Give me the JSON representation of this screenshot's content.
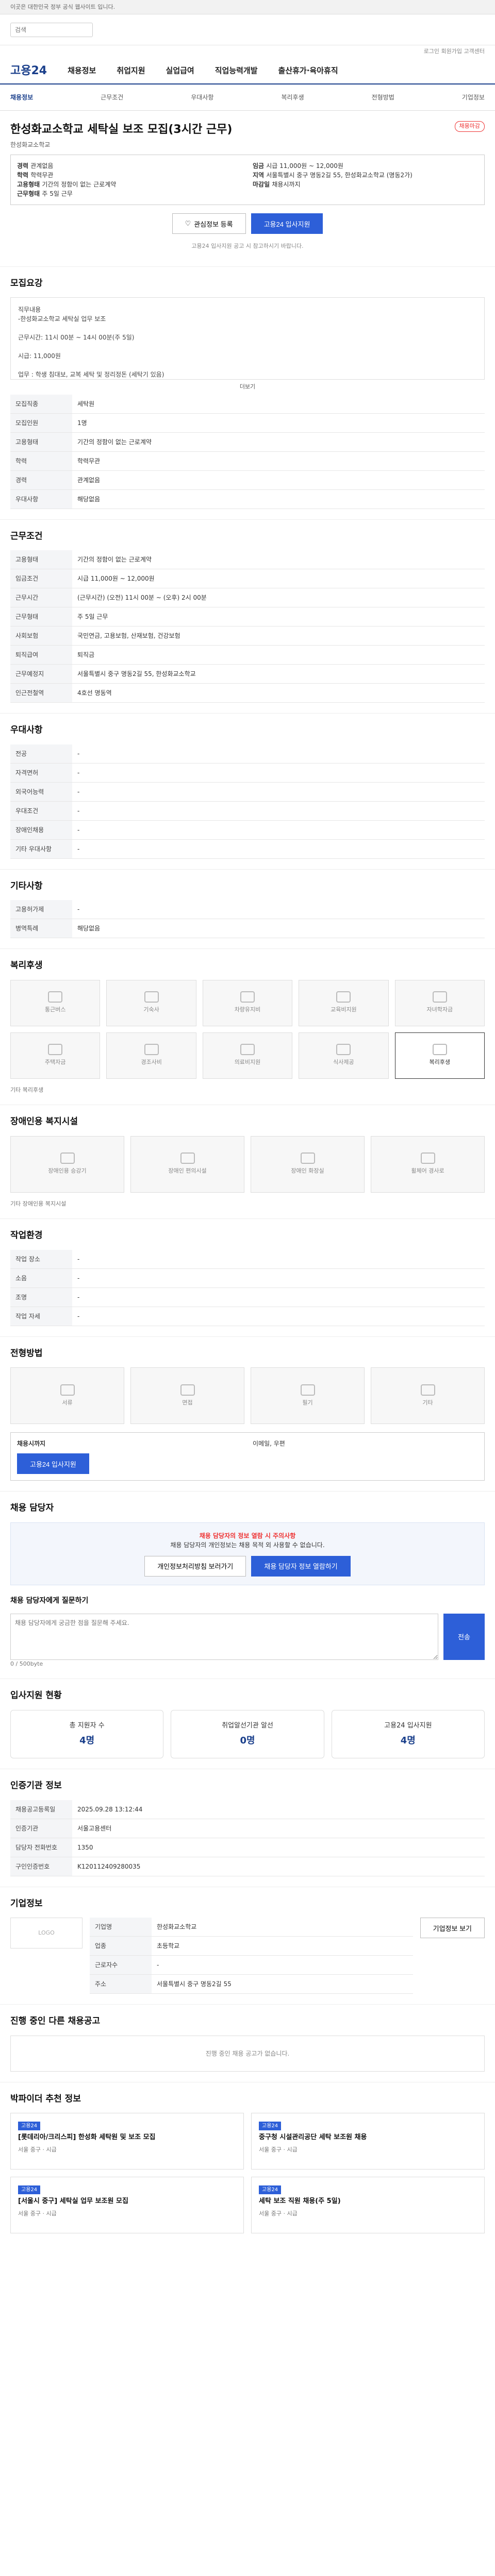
{
  "topbar": "이곳은 대한민국 정부 공식 웹사이트 입니다.",
  "header": {
    "search_placeholder": "검색",
    "util": "로그인  회원가입  고객센터"
  },
  "gnb": {
    "logo": "고용24",
    "menu": [
      "채용정보",
      "취업지원",
      "실업급여",
      "직업능력개발",
      "출산휴가·육아휴직"
    ]
  },
  "tabs": [
    "채용정보",
    "근무조건",
    "우대사항",
    "복리후생",
    "전형방법",
    "기업정보"
  ],
  "job": {
    "badge": "채용마감",
    "title": "한성화교소학교 세탁실 보조 모집(3시간 근무)",
    "company": "한성화교소학교"
  },
  "summary": {
    "left": [
      [
        "경력",
        "관계없음"
      ],
      [
        "학력",
        "학력무관"
      ],
      [
        "고용형태",
        "기간의 정함이 없는 근로계약"
      ],
      [
        "근무형태",
        "주 5일 근무"
      ]
    ],
    "right": [
      [
        "임금",
        "시급 11,000원 ~ 12,000원"
      ],
      [
        "지역",
        "서울특별시 중구 명동2길 55, 한성화교소학교 (명동2가)"
      ],
      [
        "마감일",
        "채용시까지"
      ]
    ]
  },
  "actions": {
    "scrap": "관심정보 등록",
    "apply": "고용24 입사지원"
  },
  "note": "고용24 입사지원 공고 시 참고하시기 바랍니다.",
  "detail": {
    "heading": "모집요강",
    "body": "직무내용\n-한성화교소학교 세탁실 업무 보조\n\n근무시간: 11시 00분 ~ 14시 00분(주 5일)\n\n시급: 11,000원\n\n업무 : 학생 침대보, 교복 세탁 및 정리정돈 (세탁기 있음)",
    "more": "더보기"
  },
  "recruit": [
    [
      "모집직종",
      "세탁원"
    ],
    [
      "모집인원",
      "1명"
    ],
    [
      "고용형태",
      "기간의 정함이 없는 근로계약"
    ],
    [
      "학력",
      "학력무관"
    ],
    [
      "경력",
      "관계없음"
    ],
    [
      "우대사항",
      "해당없음"
    ]
  ],
  "condition_heading": "근무조건",
  "condition": [
    [
      "고용형태",
      "기간의 정함이 없는 근로계약"
    ],
    [
      "임금조건",
      "시급 11,000원 ~ 12,000원"
    ],
    [
      "근무시간",
      "(근무시간) (오전) 11시 00분 ~ (오후) 2시 00분"
    ],
    [
      "근무형태",
      "주 5일 근무"
    ],
    [
      "사회보험",
      "국민연금, 고용보험, 산재보험, 건강보험"
    ],
    [
      "퇴직급여",
      "퇴직금"
    ],
    [
      "근무예정지",
      "서울특별시 중구 명동2길 55, 한성화교소학교"
    ],
    [
      "인근전철역",
      "4호선 명동역"
    ]
  ],
  "pref_heading": "우대사항",
  "pref": [
    [
      "전공",
      "-"
    ],
    [
      "자격면허",
      "-"
    ],
    [
      "외국어능력",
      "-"
    ],
    [
      "우대조건",
      "-"
    ],
    [
      "장애인채용",
      "-"
    ],
    [
      "기타 우대사항",
      "-"
    ]
  ],
  "etc_heading": "기타사항",
  "etc": [
    [
      "고용허가제",
      "-"
    ],
    [
      "병역특례",
      "해당없음"
    ]
  ],
  "welfare_heading": "복리후생",
  "welfare": [
    "통근버스",
    "기숙사",
    "차량유지비",
    "교육비지원",
    "자녀학자금",
    "주택자금",
    "경조사비",
    "의료비지원",
    "식사제공",
    "복리후생"
  ],
  "welfare_etc": "기타 복리후생",
  "facility_heading": "장애인용 복지시설",
  "facility": [
    "장애인용 승강기",
    "장애인 편의시설",
    "장애인 화장실",
    "휠체어 경사로"
  ],
  "facility_etc": "기타 장애인용 복지시설",
  "env_heading": "작업환경",
  "env": [
    [
      "작업 장소",
      "-"
    ],
    [
      "소음",
      "-"
    ],
    [
      "조명",
      "-"
    ],
    [
      "작업 자세",
      "-"
    ]
  ],
  "method_heading": "전형방법",
  "method": [
    "서류",
    "면접",
    "필기",
    "기타"
  ],
  "apply": {
    "deadline": "채용시까지",
    "method": "이메일, 우편",
    "button": "고용24 입사지원"
  },
  "contact_heading": "채용 담당자",
  "contact": {
    "msg": "채용 담당자의 정보 열람 시 주의사항",
    "sub": "채용 담당자의 개인정보는 채용 목적 외 사용할 수 없습니다.",
    "btn1": "개인정보처리방침 보러가기",
    "btn2": "채용 담당자 정보 열람하기"
  },
  "ask": {
    "heading": "채용 담당자에게 질문하기",
    "placeholder": "채용 담당자에게 궁금한 점을 질문해 주세요.",
    "count": "0 / 500byte",
    "button": "전송"
  },
  "stats_heading": "입사지원 현황",
  "stats": [
    [
      "총 지원자 수",
      "4명"
    ],
    [
      "취업알선기관 알선",
      "0명"
    ],
    [
      "고용24 입사지원",
      "4명"
    ]
  ],
  "agency_heading": "인증기관 정보",
  "agency": [
    [
      "채용공고등록일",
      "2025.09.28 13:12:44"
    ],
    [
      "인증기관",
      "서울고용센터"
    ],
    [
      "담당자 전화번호",
      "1350"
    ],
    [
      "구인인증번호",
      "K120112409280035"
    ]
  ],
  "company_heading": "기업정보",
  "company": {
    "logo": "LOGO",
    "name": "한성화교소학교",
    "fields": [
      [
        "기업명",
        "한성화교소학교"
      ],
      [
        "업종",
        "초등학교"
      ],
      [
        "근로자수",
        "-"
      ],
      [
        "주소",
        "서울특별시 중구 명동2길 55"
      ]
    ],
    "button": "기업정보 보기"
  },
  "other_heading": "진행 중인 다른 채용공고",
  "other_empty": "진행 중인 채용 공고가 없습니다.",
  "recommend_heading": "박파이더 추천 정보",
  "recommend": [
    {
      "tag": "고용24",
      "title": "[롯데리아/크리스피] 한성화 세탁원 및 보조 모집",
      "meta": "서울 중구 · 시급"
    },
    {
      "tag": "고용24",
      "title": "중구청 시설관리공단 세탁 보조원 채용",
      "meta": "서울 중구 · 시급"
    },
    {
      "tag": "고용24",
      "title": "[서울시 중구] 세탁실 업무 보조원 모집",
      "meta": "서울 중구 · 시급"
    },
    {
      "tag": "고용24",
      "title": "세탁 보조 직원 채용(주 5일)",
      "meta": "서울 중구 · 시급"
    }
  ]
}
